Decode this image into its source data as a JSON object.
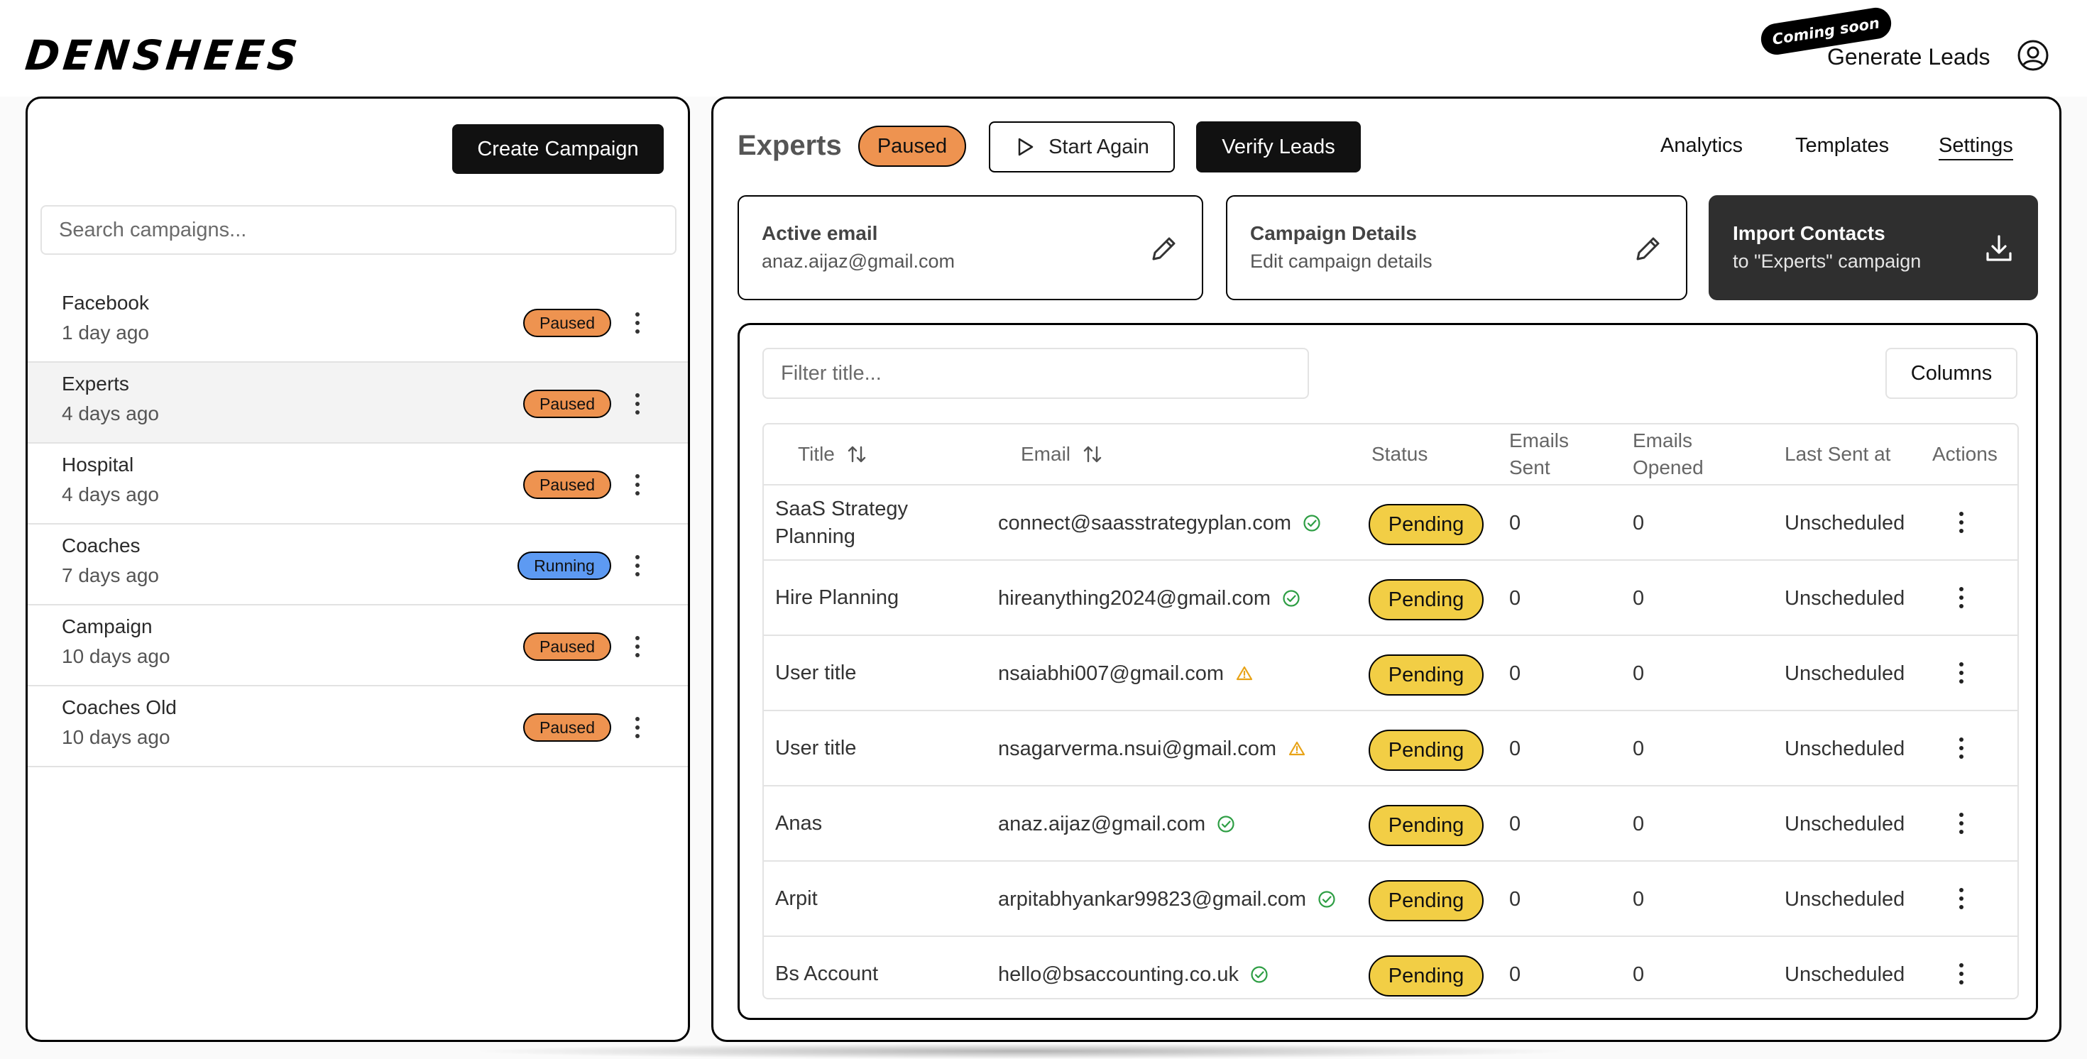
{
  "brand": {
    "logo": "DENSHEES"
  },
  "topnav": {
    "coming_soon": "Coming soon",
    "generate_leads": "Generate Leads"
  },
  "left": {
    "create_button": "Create Campaign",
    "search_placeholder": "Search campaigns...",
    "campaigns": [
      {
        "name": "Facebook",
        "time": "1 day ago",
        "status": "Paused"
      },
      {
        "name": "Experts",
        "time": "4 days ago",
        "status": "Paused"
      },
      {
        "name": "Hospital",
        "time": "4 days ago",
        "status": "Paused"
      },
      {
        "name": "Coaches",
        "time": "7 days ago",
        "status": "Running"
      },
      {
        "name": "Campaign",
        "time": "10 days ago",
        "status": "Paused"
      },
      {
        "name": "Coaches Old",
        "time": "10 days ago",
        "status": "Paused"
      }
    ]
  },
  "header": {
    "title": "Experts",
    "status": "Paused",
    "start_again": "Start Again",
    "verify_leads": "Verify Leads",
    "nav": {
      "analytics": "Analytics",
      "templates": "Templates",
      "settings": "Settings"
    }
  },
  "cards": {
    "active_email": {
      "title": "Active email",
      "value": "anaz.aijaz@gmail.com"
    },
    "campaign_details": {
      "title": "Campaign Details",
      "value": "Edit campaign details"
    },
    "import_contacts": {
      "title": "Import Contacts",
      "value": "to \"Experts\" campaign"
    }
  },
  "table": {
    "filter_placeholder": "Filter title...",
    "columns_button": "Columns",
    "headers": {
      "title": "Title",
      "email": "Email",
      "status": "Status",
      "emails_sent": "Emails Sent",
      "emails_opened": "Emails Opened",
      "last_sent": "Last Sent at",
      "actions": "Actions"
    },
    "rows": [
      {
        "title": "SaaS Strategy Planning",
        "email": "connect@saasstrategyplan.com",
        "verified": "verified",
        "status": "Pending",
        "sent": "0",
        "opened": "0",
        "last_sent": "Unscheduled"
      },
      {
        "title": "Hire Planning",
        "email": "hireanything2024@gmail.com",
        "verified": "verified",
        "status": "Pending",
        "sent": "0",
        "opened": "0",
        "last_sent": "Unscheduled"
      },
      {
        "title": "User title",
        "email": "nsaiabhi007@gmail.com",
        "verified": "warning",
        "status": "Pending",
        "sent": "0",
        "opened": "0",
        "last_sent": "Unscheduled"
      },
      {
        "title": "User title",
        "email": "nsagarverma.nsui@gmail.com",
        "verified": "warning",
        "status": "Pending",
        "sent": "0",
        "opened": "0",
        "last_sent": "Unscheduled"
      },
      {
        "title": "Anas",
        "email": "anaz.aijaz@gmail.com",
        "verified": "verified",
        "status": "Pending",
        "sent": "0",
        "opened": "0",
        "last_sent": "Unscheduled"
      },
      {
        "title": "Arpit",
        "email": "arpitabhyankar99823@gmail.com",
        "verified": "verified",
        "status": "Pending",
        "sent": "0",
        "opened": "0",
        "last_sent": "Unscheduled"
      },
      {
        "title": "Bs Account",
        "email": "hello@bsaccounting.co.uk",
        "verified": "verified",
        "status": "Pending",
        "sent": "0",
        "opened": "0",
        "last_sent": "Unscheduled"
      }
    ]
  },
  "colors": {
    "paused": "#ee9350",
    "running": "#5d9af2",
    "pending": "#f2ce45",
    "verified": "#2e9e44",
    "warning": "#e8a317"
  }
}
